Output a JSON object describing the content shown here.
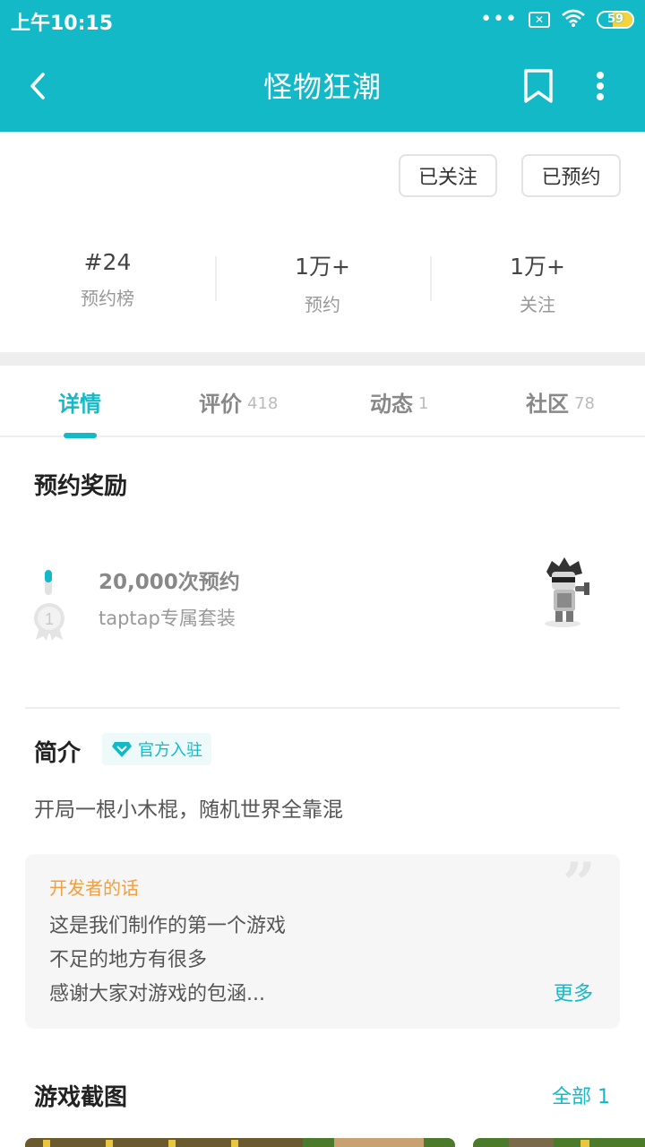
{
  "status_bar": {
    "time": "上午10:15",
    "battery": "59",
    "battery_level": 0.59
  },
  "header": {
    "title": "怪物狂潮",
    "back_icon": "back-arrow-icon",
    "bookmark_icon": "bookmark-icon",
    "more_icon": "more-vertical-icon",
    "bg_color": "#14b9c8"
  },
  "actions": {
    "follow_label": "已关注",
    "reserve_label": "已预约"
  },
  "stats": [
    {
      "value": "#24",
      "label": "预约榜"
    },
    {
      "value": "1万+",
      "label": "预约"
    },
    {
      "value": "1万+",
      "label": "关注"
    }
  ],
  "tabs": [
    {
      "label": "详情",
      "count": ""
    },
    {
      "label": "评价",
      "count": "418"
    },
    {
      "label": "动态",
      "count": "1"
    },
    {
      "label": "社区",
      "count": "78"
    }
  ],
  "reward": {
    "section_title": "预约奖励",
    "milestone": "20,000次预约",
    "description": "taptap专属套装",
    "medal_number": "1",
    "progress": 0.5
  },
  "intro": {
    "section_title": "简介",
    "badge": "官方入驻",
    "text": "开局一根小木棍，随机世界全靠混"
  },
  "developer_note": {
    "title": "开发者的话",
    "lines": [
      "这是我们制作的第一个游戏",
      "不足的地方有很多",
      "感谢大家对游戏的包涵..."
    ],
    "more": "更多",
    "quote_mark": "”"
  },
  "screenshots": {
    "section_title": "游戏截图",
    "all_label": "全部 1"
  },
  "colors": {
    "accent": "#14b9c8",
    "dev_title": "#f0a040"
  }
}
